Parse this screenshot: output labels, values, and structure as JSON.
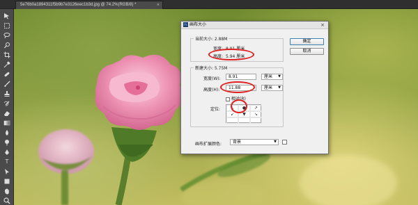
{
  "document_tab": {
    "title": "5e76b0a1894311f5b9b7e3126eec1b3d.jpg @ 74.2%(RGB/8) *",
    "close_glyph": "×"
  },
  "tools": [
    "move-icon",
    "marquee-icon",
    "lasso-icon",
    "quick-select-icon",
    "crop-icon",
    "eyedropper-icon",
    "healing-brush-icon",
    "brush-icon",
    "clone-stamp-icon",
    "history-brush-icon",
    "eraser-icon",
    "gradient-icon",
    "blur-icon",
    "dodge-icon",
    "pen-icon",
    "type-icon",
    "path-select-icon",
    "shape-icon",
    "hand-icon",
    "zoom-icon"
  ],
  "dialog": {
    "title": "画布大小",
    "close_glyph": "×",
    "current": {
      "group_label": "当前大小: 2.88M",
      "width_label": "宽度:",
      "width_value": "8.91 厘米",
      "height_label": "高度:",
      "height_value": "5.94 厘米"
    },
    "new": {
      "group_label": "新建大小: 5.75M",
      "width_label": "宽度(W):",
      "width_value": "8.91",
      "width_unit": "厘米",
      "height_label": "高度(H):",
      "height_value": "11.88",
      "height_unit": "厘米",
      "relative_label": "相对(R)",
      "anchor_label": "定位:",
      "anchor_cells": [
        "↖",
        "●",
        "↗",
        "↙",
        "▼",
        "↘",
        "",
        "",
        ""
      ]
    },
    "ext_color_label": "画布扩展颜色:",
    "ext_color_value": "背景",
    "ok_label": "确定",
    "cancel_label": "取消"
  },
  "colors": {
    "highlight_ring": "#e02020",
    "petal": "#e77fa6"
  }
}
